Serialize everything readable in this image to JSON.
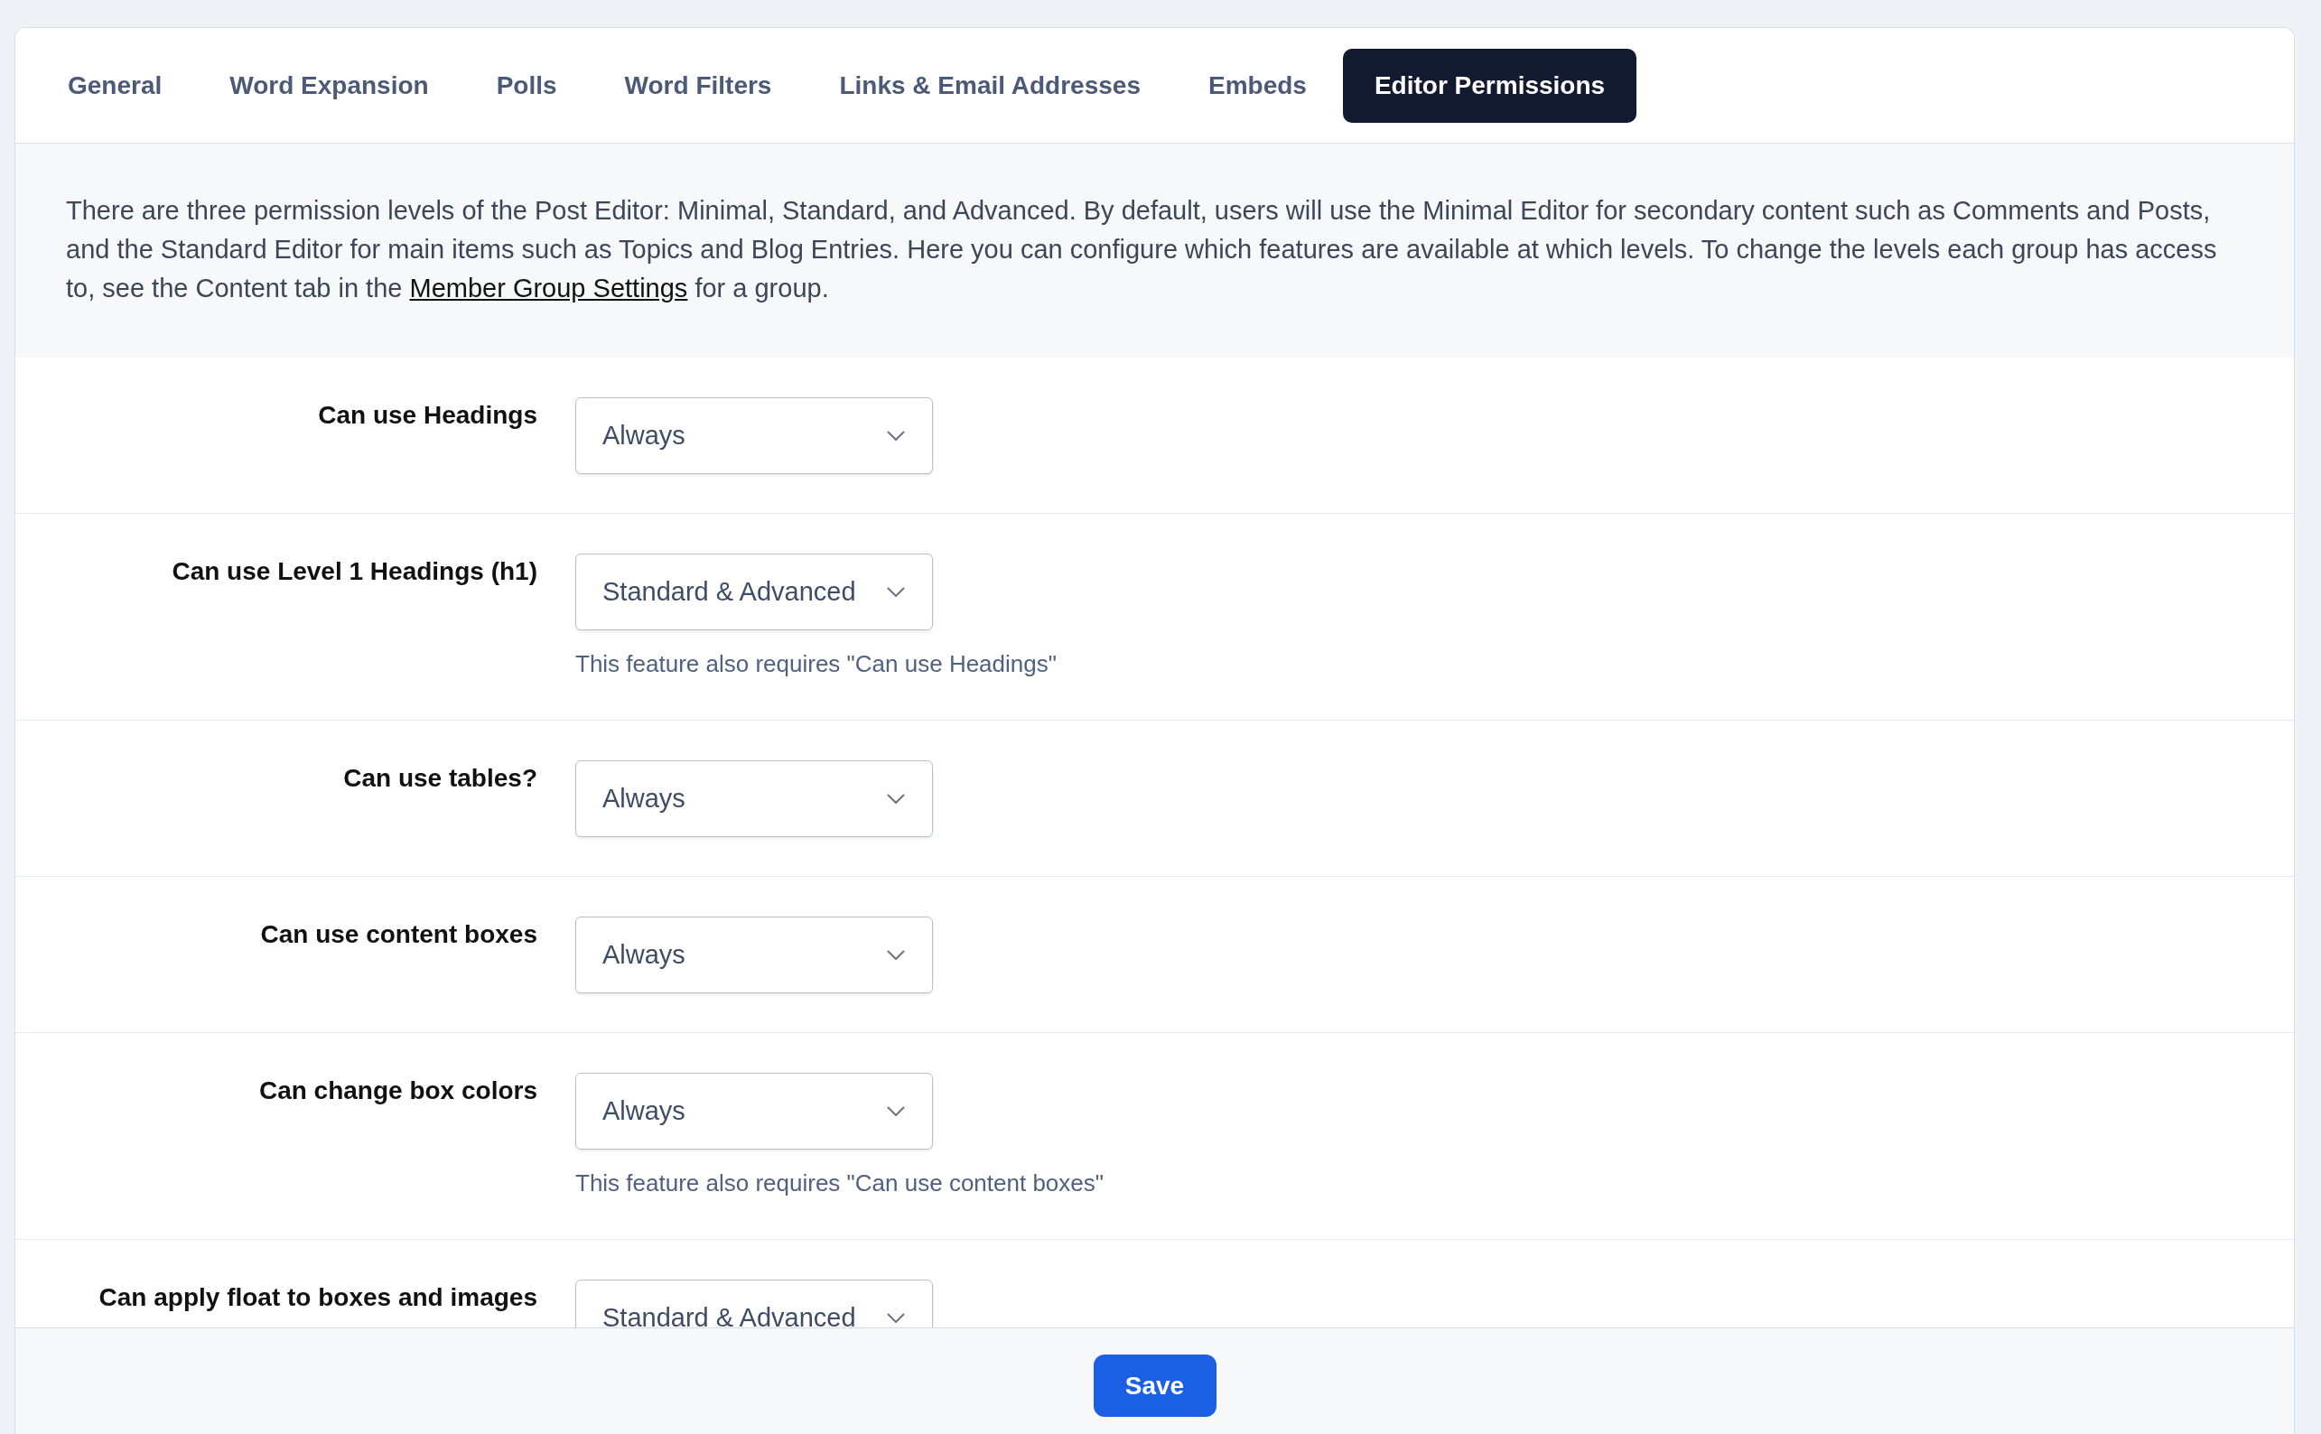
{
  "tabs": [
    {
      "label": "General",
      "selected": false
    },
    {
      "label": "Word Expansion",
      "selected": false
    },
    {
      "label": "Polls",
      "selected": false
    },
    {
      "label": "Word Filters",
      "selected": false
    },
    {
      "label": "Links & Email Addresses",
      "selected": false
    },
    {
      "label": "Embeds",
      "selected": false
    },
    {
      "label": "Editor Permissions",
      "selected": true
    }
  ],
  "intro": {
    "text_before": "There are three permission levels of the Post Editor: Minimal, Standard, and Advanced. By default, users will use the Minimal Editor for secondary content such as Comments and Posts, and the Standard Editor for main items such as Topics and Blog Entries. Here you can configure which features are available at which levels. To change the levels each group has access to, see the Content tab in the ",
    "link": "Member Group Settings",
    "text_after": " for a group."
  },
  "settings": [
    {
      "label": "Can use Headings",
      "value": "Always"
    },
    {
      "label": "Can use Level 1 Headings (h1)",
      "value": "Standard & Advanced",
      "hint": "This feature also requires \"Can use Headings\""
    },
    {
      "label": "Can use tables?",
      "value": "Always"
    },
    {
      "label": "Can use content boxes",
      "value": "Always"
    },
    {
      "label": "Can change box colors",
      "value": "Always",
      "hint": "This feature also requires \"Can use content boxes\""
    },
    {
      "label": "Can apply float to boxes and images",
      "value": "Standard & Advanced"
    }
  ],
  "save_button": "Save"
}
